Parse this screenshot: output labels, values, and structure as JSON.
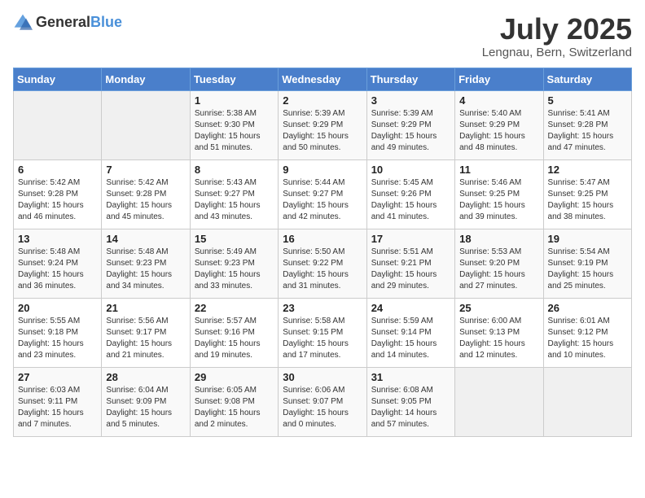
{
  "header": {
    "logo_general": "General",
    "logo_blue": "Blue",
    "month_year": "July 2025",
    "location": "Lengnau, Bern, Switzerland"
  },
  "weekdays": [
    "Sunday",
    "Monday",
    "Tuesday",
    "Wednesday",
    "Thursday",
    "Friday",
    "Saturday"
  ],
  "weeks": [
    [
      {
        "day": "",
        "sunrise": "",
        "sunset": "",
        "daylight": ""
      },
      {
        "day": "",
        "sunrise": "",
        "sunset": "",
        "daylight": ""
      },
      {
        "day": "1",
        "sunrise": "Sunrise: 5:38 AM",
        "sunset": "Sunset: 9:30 PM",
        "daylight": "Daylight: 15 hours and 51 minutes."
      },
      {
        "day": "2",
        "sunrise": "Sunrise: 5:39 AM",
        "sunset": "Sunset: 9:29 PM",
        "daylight": "Daylight: 15 hours and 50 minutes."
      },
      {
        "day": "3",
        "sunrise": "Sunrise: 5:39 AM",
        "sunset": "Sunset: 9:29 PM",
        "daylight": "Daylight: 15 hours and 49 minutes."
      },
      {
        "day": "4",
        "sunrise": "Sunrise: 5:40 AM",
        "sunset": "Sunset: 9:29 PM",
        "daylight": "Daylight: 15 hours and 48 minutes."
      },
      {
        "day": "5",
        "sunrise": "Sunrise: 5:41 AM",
        "sunset": "Sunset: 9:28 PM",
        "daylight": "Daylight: 15 hours and 47 minutes."
      }
    ],
    [
      {
        "day": "6",
        "sunrise": "Sunrise: 5:42 AM",
        "sunset": "Sunset: 9:28 PM",
        "daylight": "Daylight: 15 hours and 46 minutes."
      },
      {
        "day": "7",
        "sunrise": "Sunrise: 5:42 AM",
        "sunset": "Sunset: 9:28 PM",
        "daylight": "Daylight: 15 hours and 45 minutes."
      },
      {
        "day": "8",
        "sunrise": "Sunrise: 5:43 AM",
        "sunset": "Sunset: 9:27 PM",
        "daylight": "Daylight: 15 hours and 43 minutes."
      },
      {
        "day": "9",
        "sunrise": "Sunrise: 5:44 AM",
        "sunset": "Sunset: 9:27 PM",
        "daylight": "Daylight: 15 hours and 42 minutes."
      },
      {
        "day": "10",
        "sunrise": "Sunrise: 5:45 AM",
        "sunset": "Sunset: 9:26 PM",
        "daylight": "Daylight: 15 hours and 41 minutes."
      },
      {
        "day": "11",
        "sunrise": "Sunrise: 5:46 AM",
        "sunset": "Sunset: 9:25 PM",
        "daylight": "Daylight: 15 hours and 39 minutes."
      },
      {
        "day": "12",
        "sunrise": "Sunrise: 5:47 AM",
        "sunset": "Sunset: 9:25 PM",
        "daylight": "Daylight: 15 hours and 38 minutes."
      }
    ],
    [
      {
        "day": "13",
        "sunrise": "Sunrise: 5:48 AM",
        "sunset": "Sunset: 9:24 PM",
        "daylight": "Daylight: 15 hours and 36 minutes."
      },
      {
        "day": "14",
        "sunrise": "Sunrise: 5:48 AM",
        "sunset": "Sunset: 9:23 PM",
        "daylight": "Daylight: 15 hours and 34 minutes."
      },
      {
        "day": "15",
        "sunrise": "Sunrise: 5:49 AM",
        "sunset": "Sunset: 9:23 PM",
        "daylight": "Daylight: 15 hours and 33 minutes."
      },
      {
        "day": "16",
        "sunrise": "Sunrise: 5:50 AM",
        "sunset": "Sunset: 9:22 PM",
        "daylight": "Daylight: 15 hours and 31 minutes."
      },
      {
        "day": "17",
        "sunrise": "Sunrise: 5:51 AM",
        "sunset": "Sunset: 9:21 PM",
        "daylight": "Daylight: 15 hours and 29 minutes."
      },
      {
        "day": "18",
        "sunrise": "Sunrise: 5:53 AM",
        "sunset": "Sunset: 9:20 PM",
        "daylight": "Daylight: 15 hours and 27 minutes."
      },
      {
        "day": "19",
        "sunrise": "Sunrise: 5:54 AM",
        "sunset": "Sunset: 9:19 PM",
        "daylight": "Daylight: 15 hours and 25 minutes."
      }
    ],
    [
      {
        "day": "20",
        "sunrise": "Sunrise: 5:55 AM",
        "sunset": "Sunset: 9:18 PM",
        "daylight": "Daylight: 15 hours and 23 minutes."
      },
      {
        "day": "21",
        "sunrise": "Sunrise: 5:56 AM",
        "sunset": "Sunset: 9:17 PM",
        "daylight": "Daylight: 15 hours and 21 minutes."
      },
      {
        "day": "22",
        "sunrise": "Sunrise: 5:57 AM",
        "sunset": "Sunset: 9:16 PM",
        "daylight": "Daylight: 15 hours and 19 minutes."
      },
      {
        "day": "23",
        "sunrise": "Sunrise: 5:58 AM",
        "sunset": "Sunset: 9:15 PM",
        "daylight": "Daylight: 15 hours and 17 minutes."
      },
      {
        "day": "24",
        "sunrise": "Sunrise: 5:59 AM",
        "sunset": "Sunset: 9:14 PM",
        "daylight": "Daylight: 15 hours and 14 minutes."
      },
      {
        "day": "25",
        "sunrise": "Sunrise: 6:00 AM",
        "sunset": "Sunset: 9:13 PM",
        "daylight": "Daylight: 15 hours and 12 minutes."
      },
      {
        "day": "26",
        "sunrise": "Sunrise: 6:01 AM",
        "sunset": "Sunset: 9:12 PM",
        "daylight": "Daylight: 15 hours and 10 minutes."
      }
    ],
    [
      {
        "day": "27",
        "sunrise": "Sunrise: 6:03 AM",
        "sunset": "Sunset: 9:11 PM",
        "daylight": "Daylight: 15 hours and 7 minutes."
      },
      {
        "day": "28",
        "sunrise": "Sunrise: 6:04 AM",
        "sunset": "Sunset: 9:09 PM",
        "daylight": "Daylight: 15 hours and 5 minutes."
      },
      {
        "day": "29",
        "sunrise": "Sunrise: 6:05 AM",
        "sunset": "Sunset: 9:08 PM",
        "daylight": "Daylight: 15 hours and 2 minutes."
      },
      {
        "day": "30",
        "sunrise": "Sunrise: 6:06 AM",
        "sunset": "Sunset: 9:07 PM",
        "daylight": "Daylight: 15 hours and 0 minutes."
      },
      {
        "day": "31",
        "sunrise": "Sunrise: 6:08 AM",
        "sunset": "Sunset: 9:05 PM",
        "daylight": "Daylight: 14 hours and 57 minutes."
      },
      {
        "day": "",
        "sunrise": "",
        "sunset": "",
        "daylight": ""
      },
      {
        "day": "",
        "sunrise": "",
        "sunset": "",
        "daylight": ""
      }
    ]
  ]
}
